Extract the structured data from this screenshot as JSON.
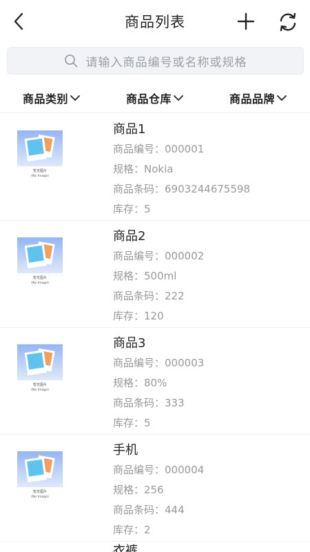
{
  "header": {
    "title": "商品列表"
  },
  "search": {
    "placeholder": "请输入商品编号或名称或规格"
  },
  "filters": [
    {
      "label": "商品类别"
    },
    {
      "label": "商品仓库"
    },
    {
      "label": "商品品牌"
    }
  ],
  "thumb": {
    "line1": "暂无图片",
    "line2": "(No Image)"
  },
  "fields": {
    "code_label": "商品编号：",
    "spec_label": "规格：",
    "barcode_label": "商品条码：",
    "stock_label": "库存："
  },
  "items": [
    {
      "name": "商品1",
      "code": "000001",
      "spec": "Nokia",
      "barcode": "6903244675598",
      "stock": "5"
    },
    {
      "name": "商品2",
      "code": "000002",
      "spec": "500ml",
      "barcode": "222",
      "stock": "120"
    },
    {
      "name": "商品3",
      "code": "000003",
      "spec": "80%",
      "barcode": "333",
      "stock": "5"
    },
    {
      "name": "手机",
      "code": "000004",
      "spec": "256",
      "barcode": "444",
      "stock": "2"
    }
  ],
  "next_item_peek": "衣裤",
  "colors": {
    "thumb_bg_top": "#93b6f4",
    "thumb_bg_bottom": "#dfe8fb",
    "photo_front": "#5fc3ee",
    "photo_back": "#f59f5c"
  }
}
